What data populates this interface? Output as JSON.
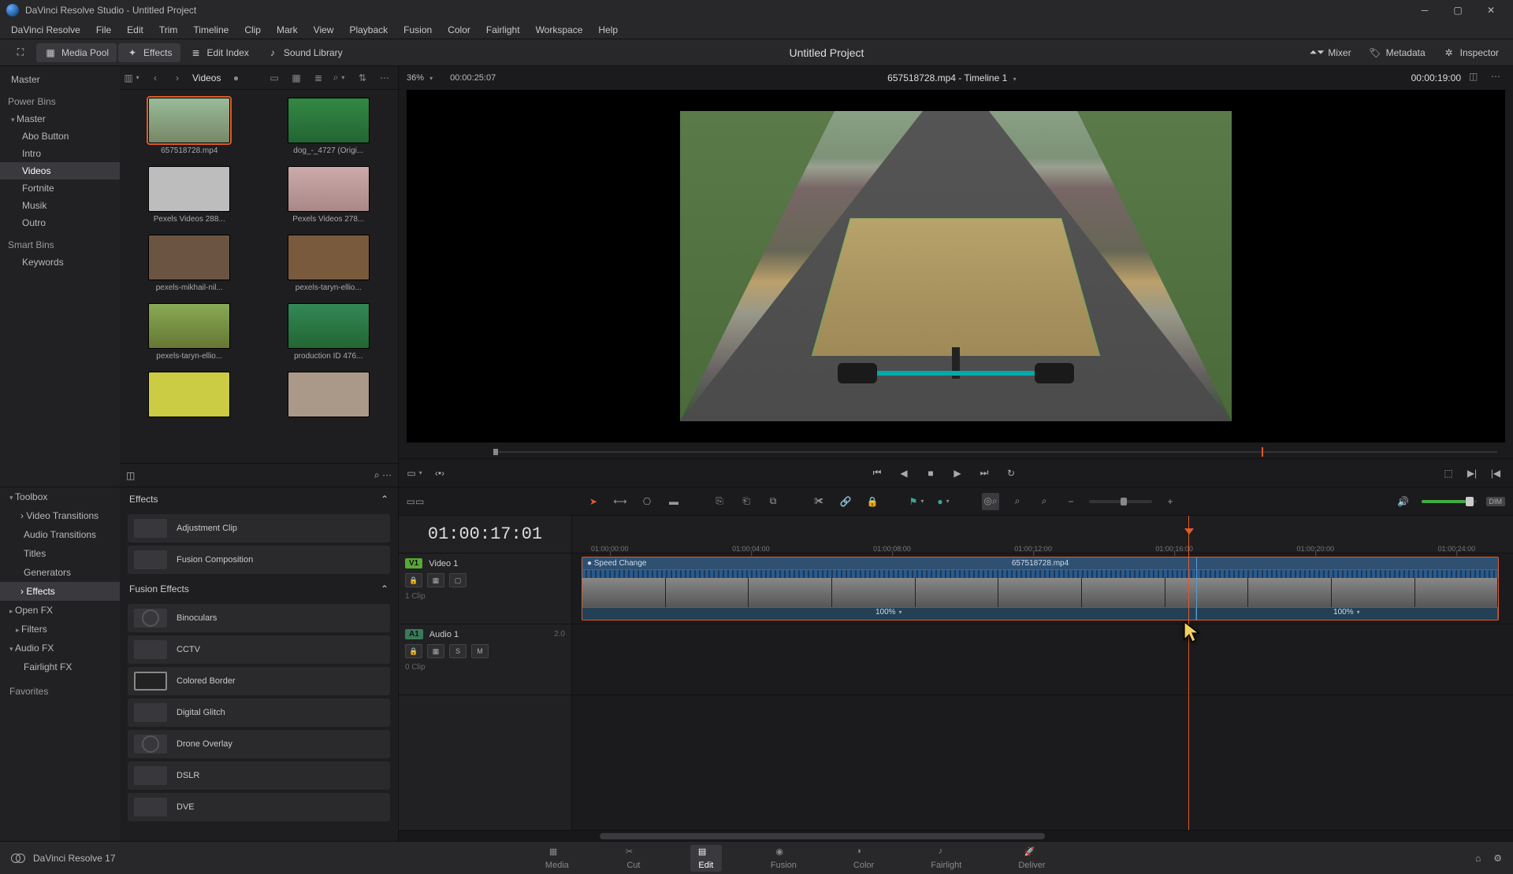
{
  "titlebar": {
    "app": "DaVinci Resolve Studio",
    "project": "Untitled Project"
  },
  "menu": [
    "DaVinci Resolve",
    "File",
    "Edit",
    "Trim",
    "Timeline",
    "Clip",
    "Mark",
    "View",
    "Playback",
    "Fusion",
    "Color",
    "Fairlight",
    "Workspace",
    "Help"
  ],
  "toolbar": {
    "media_pool": "Media Pool",
    "effects": "Effects",
    "edit_index": "Edit Index",
    "sound_library": "Sound Library",
    "project_title": "Untitled Project",
    "mixer": "Mixer",
    "metadata": "Metadata",
    "inspector": "Inspector"
  },
  "bins": {
    "master": "Master",
    "power_bins": "Power Bins",
    "pb_master": "Master",
    "pb_items": [
      "Abo Button",
      "Intro",
      "Videos",
      "Fortnite",
      "Musik",
      "Outro"
    ],
    "pb_selected": "Videos",
    "smart_bins": "Smart Bins",
    "keywords": "Keywords"
  },
  "thumbs_header": {
    "label": "Videos"
  },
  "thumbs": [
    {
      "name": "657518728.mp4",
      "cls": "bike",
      "selected": true
    },
    {
      "name": "dog_-_4727 (Origi...",
      "cls": "dog"
    },
    {
      "name": "Pexels Videos 288...",
      "cls": "gray"
    },
    {
      "name": "Pexels Videos 278...",
      "cls": "pink"
    },
    {
      "name": "pexels-mikhail-nil...",
      "cls": "brown"
    },
    {
      "name": "pexels-taryn-ellio...",
      "cls": "brown2"
    },
    {
      "name": "pexels-taryn-ellio...",
      "cls": "warm"
    },
    {
      "name": "production ID 476...",
      "cls": "green"
    },
    {
      "name": "",
      "cls": "yellow"
    },
    {
      "name": "",
      "cls": "face"
    }
  ],
  "viewer": {
    "zoom": "36%",
    "duration": "00:00:25:07",
    "title": "657518728.mp4 - Timeline 1",
    "tc": "00:00:19:00"
  },
  "fx_tree": {
    "toolbox": "Toolbox",
    "video_transitions": "Video Transitions",
    "audio_transitions": "Audio Transitions",
    "titles": "Titles",
    "generators": "Generators",
    "effects": "Effects",
    "open_fx": "Open FX",
    "filters": "Filters",
    "audio_fx": "Audio FX",
    "fairlight_fx": "Fairlight FX",
    "favorites": "Favorites"
  },
  "fx_panel": {
    "effects_hdr": "Effects",
    "adjustment_clip": "Adjustment Clip",
    "fusion_composition": "Fusion Composition",
    "fusion_effects_hdr": "Fusion Effects",
    "list": [
      "Binoculars",
      "CCTV",
      "Colored Border",
      "Digital Glitch",
      "Drone Overlay",
      "DSLR",
      "DVE"
    ]
  },
  "timeline": {
    "tc": "01:00:17:01",
    "v1_badge": "V1",
    "v1_name": "Video 1",
    "v1_meta": "1 Clip",
    "a1_badge": "A1",
    "a1_name": "Audio 1",
    "a1_ch": "2.0",
    "a1_s": "S",
    "a1_m": "M",
    "a1_meta": "0 Clip",
    "ticks": [
      "01:00:00:00",
      "01:00:04:00",
      "01:00:08:00",
      "01:00:12:00",
      "01:00:16:00",
      "01:00:20:00",
      "01:00:24:00"
    ],
    "clip": {
      "speed_label": "Speed Change",
      "name": "657518728.mp4",
      "speed1": "100%",
      "speed2": "100%"
    },
    "dim": "DIM"
  },
  "pages": {
    "version": "DaVinci Resolve 17",
    "media": "Media",
    "cut": "Cut",
    "edit": "Edit",
    "fusion": "Fusion",
    "color": "Color",
    "fairlight": "Fairlight",
    "deliver": "Deliver"
  }
}
